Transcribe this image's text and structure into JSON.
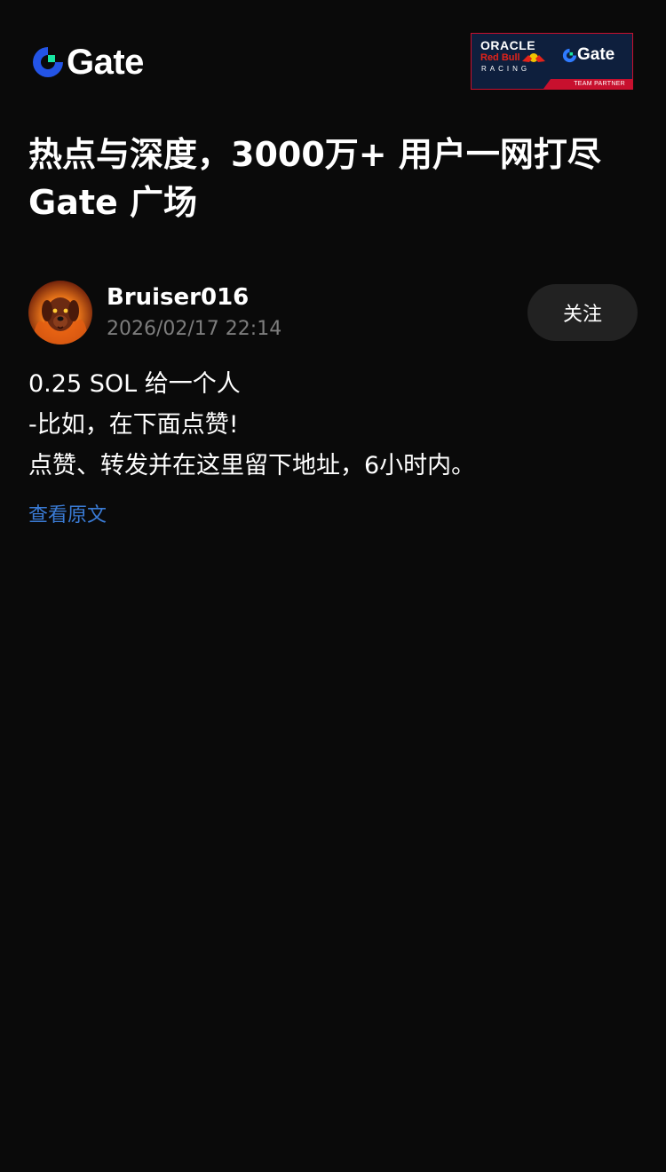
{
  "header": {
    "logo_text": "Gate",
    "logo_icon": "gate-logo-icon",
    "partner": {
      "oracle": "ORACLE",
      "redbull": "Red Bull",
      "racing": "RACING",
      "gate": "Gate",
      "team_partner": "TEAM PARTNER"
    }
  },
  "headline": {
    "line1": "热点与深度，3000万+ 用户一网打尽",
    "line2": "Gate 广场"
  },
  "post": {
    "username": "Bruiser016",
    "timestamp": "2026/02/17 22:14",
    "follow_label": "关注",
    "body_lines": [
      "0.25 SOL 给一个人",
      "-比如，在下面点赞!",
      "点赞、转发并在这里留下地址，6小时内。"
    ],
    "view_original": "查看原文"
  },
  "colors": {
    "background": "#0a0a0a",
    "brand_blue": "#2354e6",
    "brand_green": "#17e5a1",
    "link": "#3a7bd5",
    "muted": "#7d7d7d",
    "button_bg": "#222222"
  }
}
